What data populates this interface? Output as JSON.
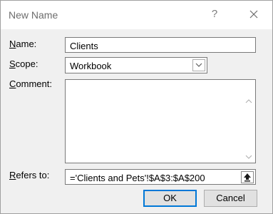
{
  "window": {
    "title": "New Name",
    "help_label": "?"
  },
  "form": {
    "name_label_prefix": "N",
    "name_label_rest": "ame:",
    "name_value": "Clients",
    "scope_label_prefix": "S",
    "scope_label_rest": "cope:",
    "scope_value": "Workbook",
    "comment_label_prefix": "C",
    "comment_label_o": "o",
    "comment_label_rest": "mment:",
    "comment_value": "",
    "refers_label_prefix": "R",
    "refers_label_rest": "efers to:",
    "refers_value": "='Clients and Pets'!$A$3:$A$200"
  },
  "buttons": {
    "ok_label": "OK",
    "cancel_label": "Cancel"
  },
  "icons": {
    "close": "close-icon",
    "scope_dropdown": "chevron-down-icon",
    "scroll_up": "chevron-up-icon",
    "scroll_down": "chevron-down-icon",
    "collapse_dialog": "collapse-dialog-icon"
  }
}
